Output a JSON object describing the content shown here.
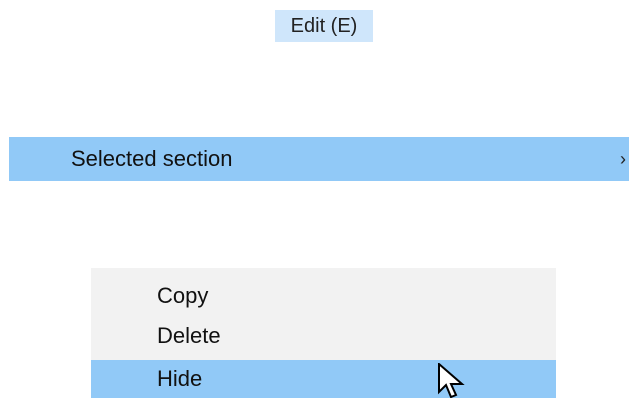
{
  "menu_title": "Edit (E)",
  "selected_section": {
    "label": "Selected section",
    "chevron": "›"
  },
  "context_menu": {
    "items": [
      {
        "label": "Copy"
      },
      {
        "label": "Delete"
      },
      {
        "label": "Hide"
      }
    ]
  },
  "icons": {
    "submenu_arrow": "chevron-right-icon",
    "cursor": "mouse-pointer-icon"
  },
  "colors": {
    "highlight": "#91C9F7",
    "title_highlight": "#CFE6FB",
    "menu_background": "#F2F2F2"
  }
}
